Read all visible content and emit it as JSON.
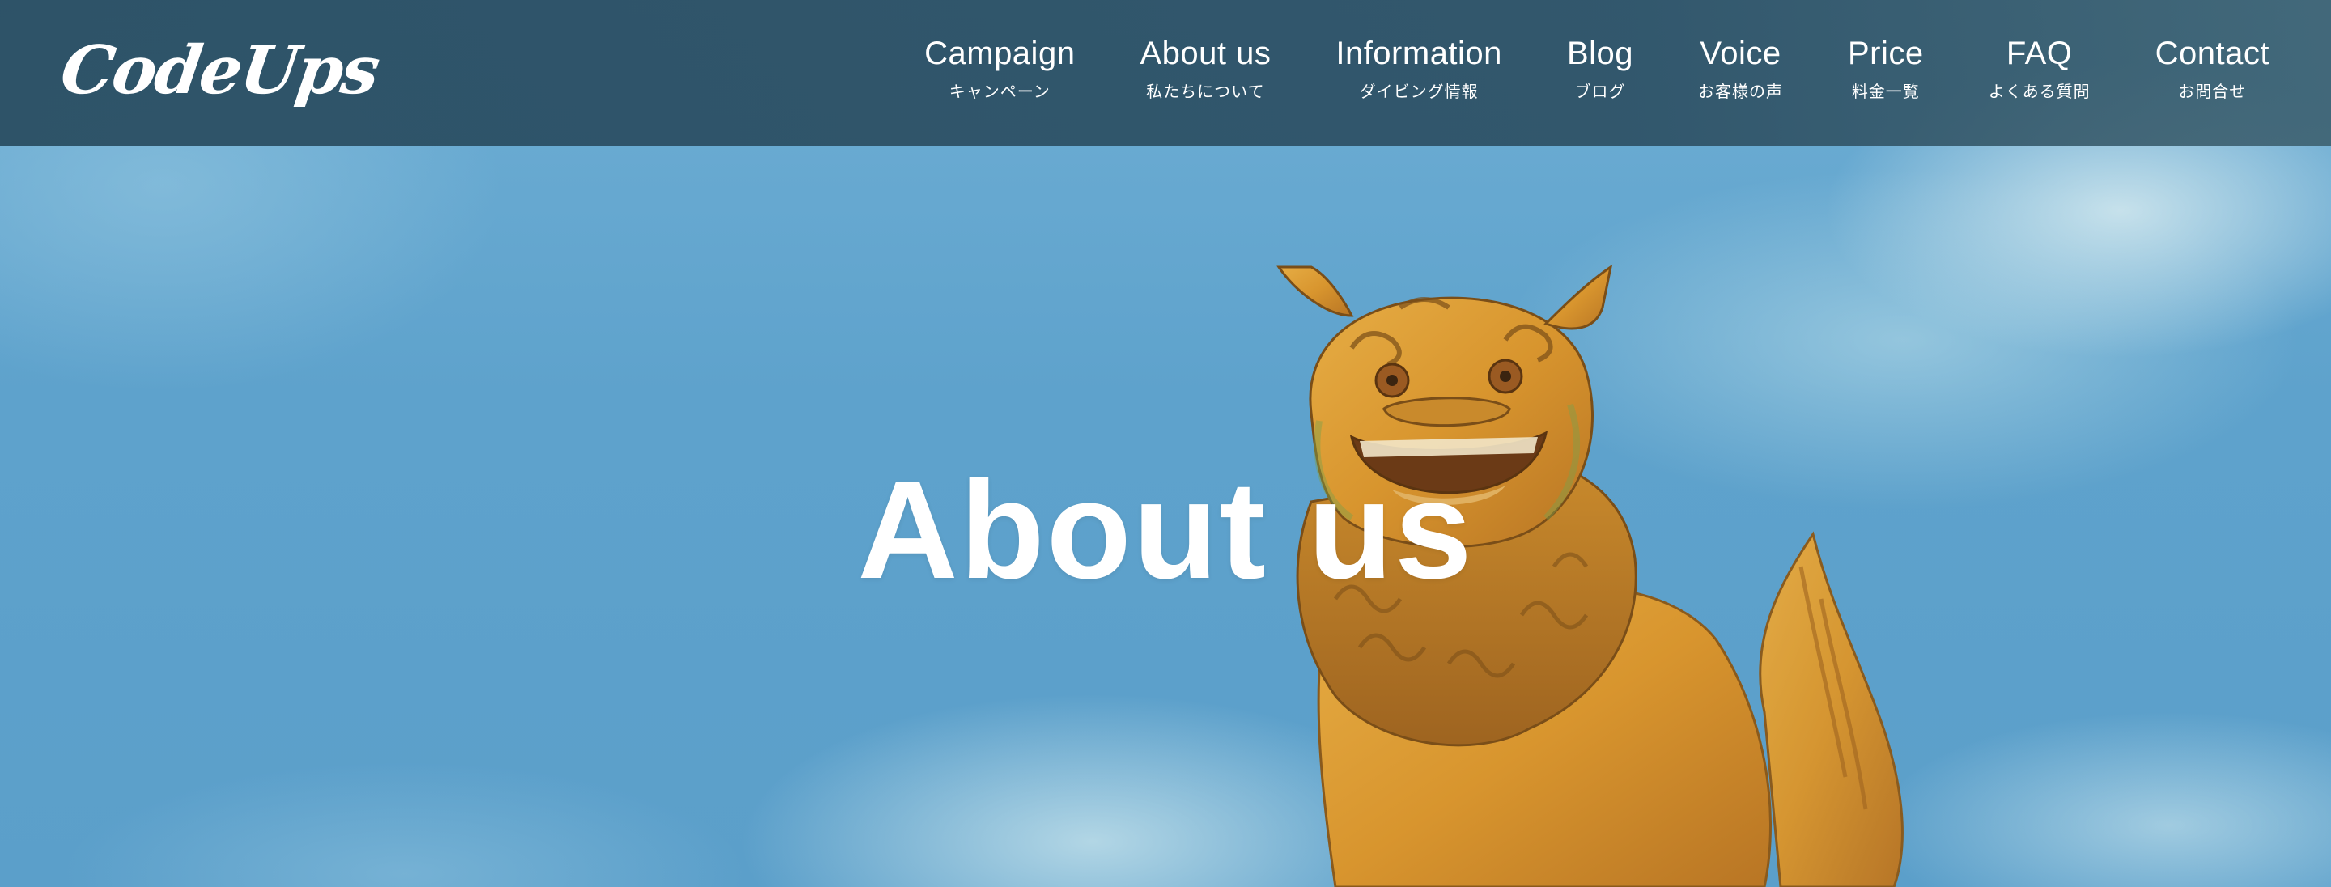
{
  "header": {
    "logo_text": "CodeUps",
    "nav": [
      {
        "label": "Campaign",
        "sub": "キャンペーン"
      },
      {
        "label": "About us",
        "sub": "私たちについて"
      },
      {
        "label": "Information",
        "sub": "ダイビング情報"
      },
      {
        "label": "Blog",
        "sub": "ブログ"
      },
      {
        "label": "Voice",
        "sub": "お客様の声"
      },
      {
        "label": "Price",
        "sub": "料金一覧"
      },
      {
        "label": "FAQ",
        "sub": "よくある質問"
      },
      {
        "label": "Contact",
        "sub": "お問合せ"
      }
    ]
  },
  "hero": {
    "title": "About us",
    "image": "shisa-statue-sky-photo"
  },
  "colors": {
    "header_bg": "#2f566b",
    "sky": "#5ea2cc",
    "text": "#ffffff",
    "statue": "#d99a35"
  }
}
